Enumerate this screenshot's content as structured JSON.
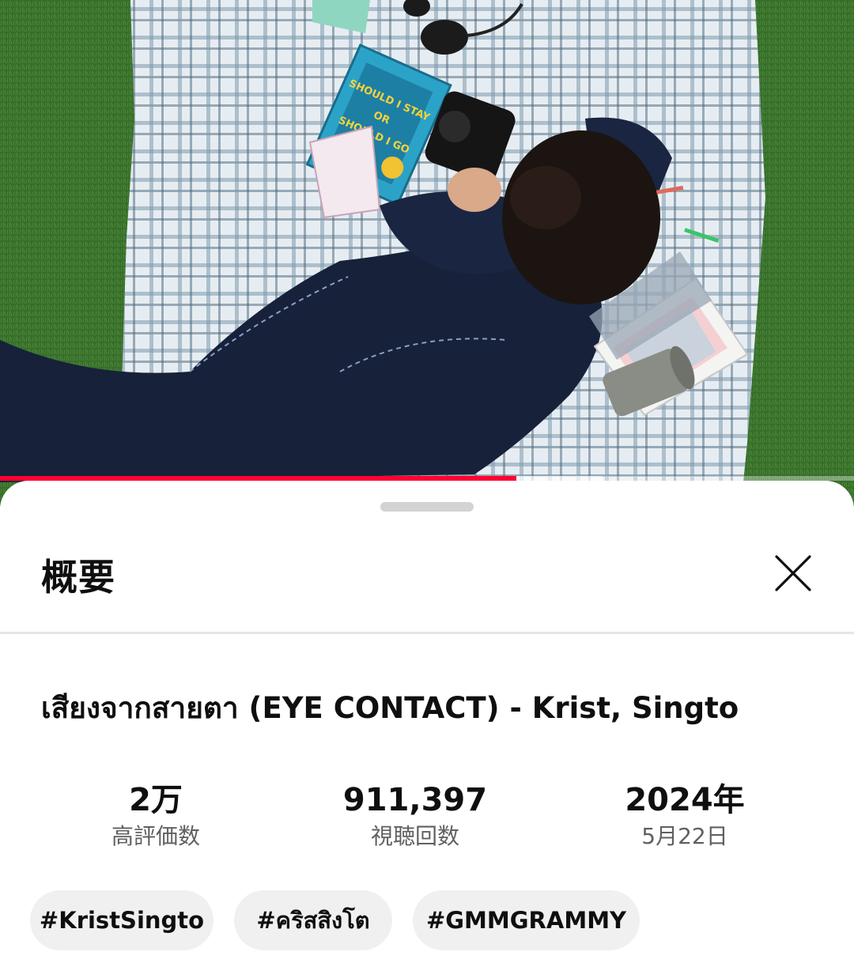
{
  "video": {
    "progress_fraction": 0.605,
    "book_cover_text": [
      "SHOULD I STAY",
      "OR",
      "SHOULD I GO"
    ]
  },
  "sheet": {
    "title": "概要",
    "video_title": "เสียงจากสายตา (EYE CONTACT) - Krist, Singto",
    "stats": [
      {
        "value": "2万",
        "label": "高評価数"
      },
      {
        "value": "911,397",
        "label": "視聴回数"
      },
      {
        "value": "2024年",
        "label": "5月22日"
      }
    ],
    "hashtags": [
      "#KristSingto",
      "#คริสสิงโต",
      "#GMMGRAMMY"
    ]
  },
  "icons": {
    "close": "close-icon"
  },
  "colors": {
    "progress": "#ff0033",
    "chip_bg": "#f0f0f0",
    "secondary_text": "#606060"
  }
}
